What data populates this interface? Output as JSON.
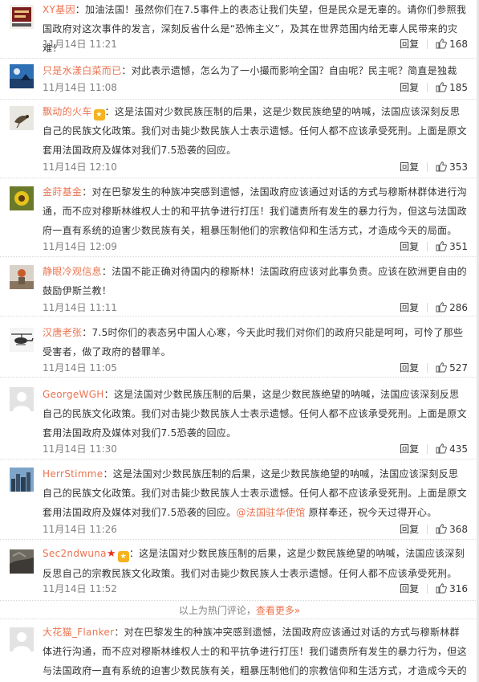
{
  "comments": [
    {
      "user": "XY基因",
      "sep": "：",
      "text": "加油法国！虽然你们在7.5事件上的表态让我们失望，但是民众是无辜的。请你们参照我国政府对这次事件的发言，深刻反省什么是“恐怖主义”，及其在世界范围内给无辜人民带来的灾难！",
      "time": "11月14日 11:21",
      "reply": "回复",
      "likes": "168",
      "avatar": "poster-icon"
    },
    {
      "user": "只是水漾白菜而已",
      "sep": "：",
      "text": "对此表示遗憾，怎么为了一小撮而影响全国？自由呢？民主呢？简直是独裁",
      "time": "11月14日 11:08",
      "reply": "回复",
      "likes": "185",
      "avatar": "sky-icon"
    },
    {
      "user": "飘动的火车",
      "sep": "：",
      "text": "这是法国对少数民族压制的后果，这是少数民族绝望的呐喊，法国应该深刻反思自己的民族文化政策。我们对击毙少数民族人士表示遗憾。任何人都不应该承受死刑。上面是原文套用法国政府及媒体对我们7.5恐袭的回应。",
      "time": "11月14日 12:10",
      "reply": "回复",
      "likes": "353",
      "avatar": "bird-icon",
      "badge": "gold"
    },
    {
      "user": "金莳基金",
      "sep": "：",
      "text": "对在巴黎发生的种族冲突感到遗憾，法国政府应该通过对话的方式与穆斯林群体进行沟通，而不应对穆斯林维权人士的和平抗争进行打压！我们谴责所有发生的暴力行为，但这与法国政府一直有系统的迫害少数民族有关，粗暴压制他们的宗教信仰和生活方式，才造成今天的局面。",
      "time": "11月14日 12:09",
      "reply": "回复",
      "likes": "351",
      "avatar": "flower-icon"
    },
    {
      "user": "静眼冷观信息",
      "sep": "：",
      "text": "法国不能正确对待国内的穆斯林！法国政府应该对此事负责。应该在欧洲更自由的鼓励伊斯兰教！",
      "time": "11月14日 11:11",
      "reply": "回复",
      "likes": "286",
      "avatar": "person-icon"
    },
    {
      "user": "汉唐老张",
      "sep": "：",
      "text": "7.5时你们的表态另中国人心寒，今天此时我们对你们的政府只能是呵呵，可怜了那些受害者，做了政府的替罪羊。",
      "time": "11月14日 11:05",
      "reply": "回复",
      "likes": "527",
      "avatar": "helicopter-icon"
    },
    {
      "user": "GeorgeWGH",
      "sep": "：",
      "text": "这是法国对少数民族压制的后果，这是少数民族绝望的呐喊，法国应该深刻反思自己的民族文化政策。我们对击毙少数民族人士表示遗憾。任何人都不应该承受死刑。上面是原文套用法国政府及媒体对我们7.5恐袭的回应。",
      "time": "11月14日 11:30",
      "reply": "回复",
      "likes": "435",
      "avatar": "default-icon"
    },
    {
      "user": "HerrStimme",
      "sep": "：",
      "text": "这是法国对少数民族压制的后果，这是少数民族绝望的呐喊，法国应该深刻反思自己的民族文化政策。我们对击毙少数民族人士表示遗憾。任何人都不应该承受死刑。上面是原文套用法国政府及媒体对我们7.5恐袭的回应。",
      "mention": "@法国驻华使馆",
      "after": " 原样奉还，祝今天过得开心。",
      "time": "11月14日 11:26",
      "reply": "回复",
      "likes": "368",
      "avatar": "city-icon"
    },
    {
      "user": "Sec2ndwuna",
      "sep": "：",
      "text": "这是法国对少数民族压制的后果，这是少数民族绝望的呐喊，法国应该深刻反思自己的宗教民族文化政策。我们对击毙少数民族人士表示遗憾。任何人都不应该承受死刑。",
      "time": "11月14日 11:52",
      "reply": "回复",
      "likes": "316",
      "avatar": "rock-icon",
      "badge": "star-gold"
    }
  ],
  "hot_tip": {
    "text": "以上为热门评论，",
    "more": "查看更多»"
  },
  "last_comment": {
    "user": "大花猫_Flanker",
    "sep": "：",
    "text": "对在巴黎发生的种族冲突感到遗憾，法国政府应该通过对话的方式与穆斯林群体进行沟通，而不应对穆斯林维权人士的和平抗争进行打压！我们谴责所有发生的暴力行为，但这与法国政府一直有系统的迫害少数民族有关，粗暴压制他们的宗教信仰和生活方式，才造成今天的局",
    "avatar": "default-icon"
  },
  "colors": {
    "link": "#eb7350",
    "meta": "#808080",
    "text": "#333333"
  }
}
